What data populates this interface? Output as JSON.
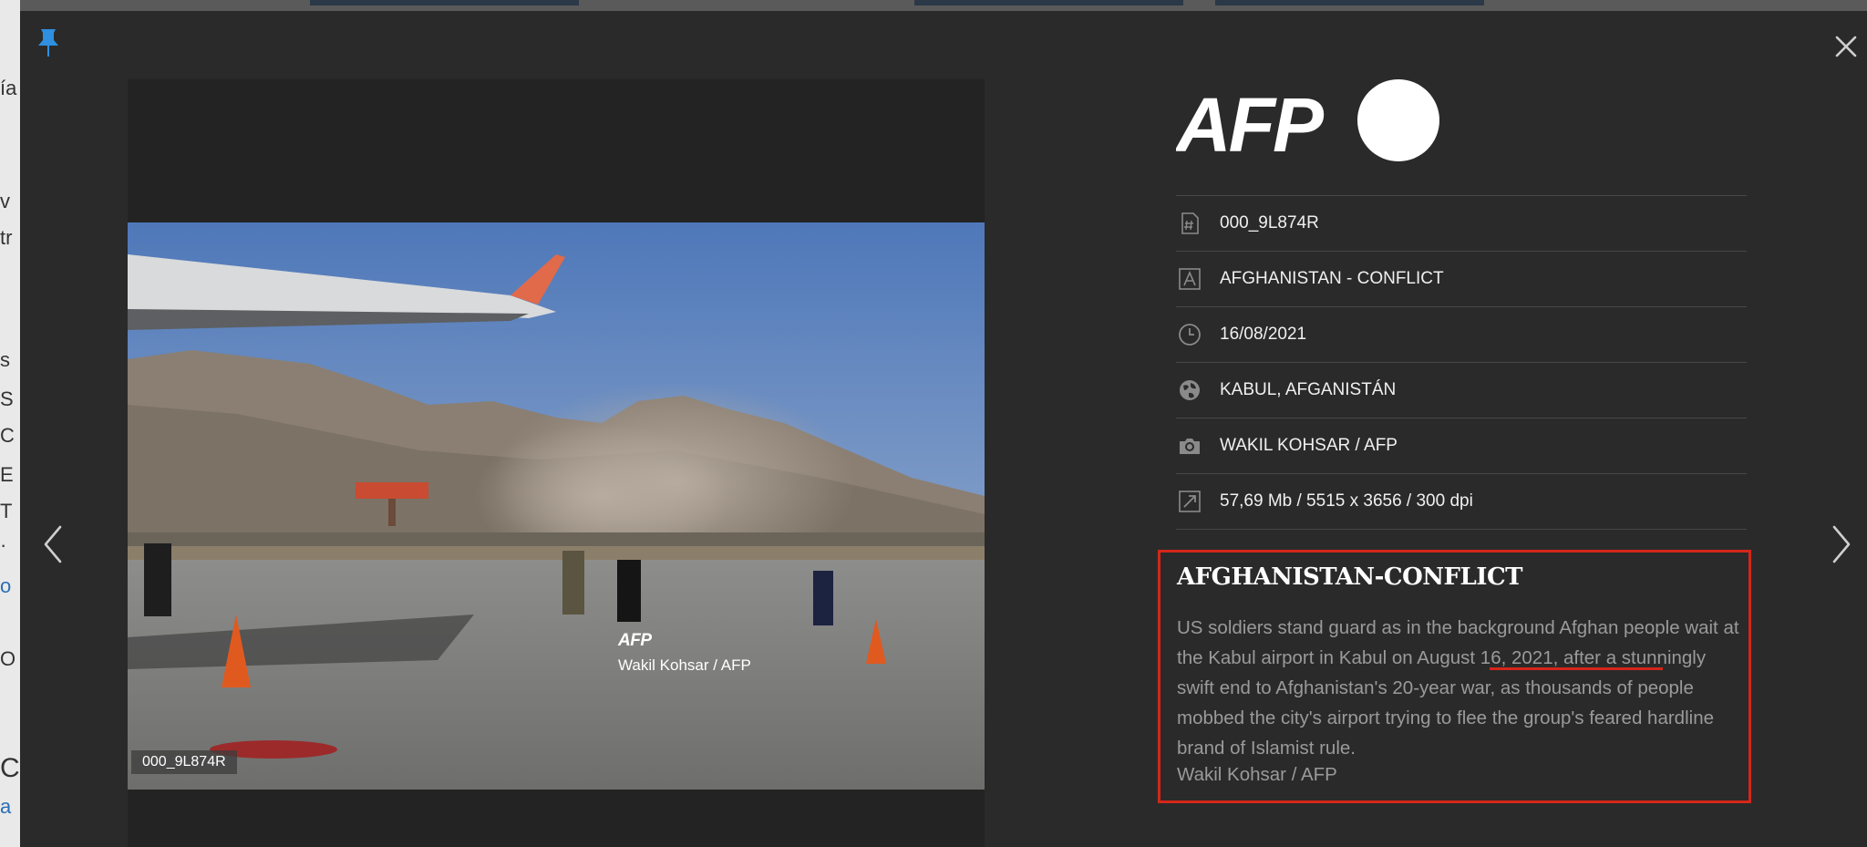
{
  "background_page": {
    "fragments": [
      "ía",
      "v",
      "tr",
      "s",
      "S",
      "C",
      "E",
      "T",
      "·",
      "o",
      "O",
      "C",
      "a"
    ]
  },
  "viewer": {
    "photo_id": "000_9L874R",
    "watermark": {
      "logo": "AFP",
      "credit": "Wakil Kohsar / AFP"
    }
  },
  "brand": {
    "logo_text": "AFP",
    "accent_color": "#d4261a"
  },
  "metadata": [
    {
      "icon": "hash-document-icon",
      "value": "000_9L874R"
    },
    {
      "icon": "letter-a-icon",
      "value": "AFGHANISTAN - CONFLICT"
    },
    {
      "icon": "clock-icon",
      "value": "16/08/2021"
    },
    {
      "icon": "globe-icon",
      "value": "KABUL, AFGANISTÁN"
    },
    {
      "icon": "camera-icon",
      "value": "WAKIL KOHSAR / AFP"
    },
    {
      "icon": "expand-icon",
      "value": "57,69 Mb / 5515 x 3656 / 300 dpi"
    }
  ],
  "caption": {
    "title": "AFGHANISTAN-CONFLICT",
    "body_before": "US soldiers stand guard as in the background Afghan people wait at the Kabul airport in Kabul on ",
    "body_date": "August 16, 2021,",
    "body_after": " after a stunningly swift end to Afghanistan's 20-year war, as thousands of people mobbed the city's airport trying to flee the group's feared hardline brand of Islamist rule.",
    "credit": "Wakil Kohsar / AFP"
  }
}
